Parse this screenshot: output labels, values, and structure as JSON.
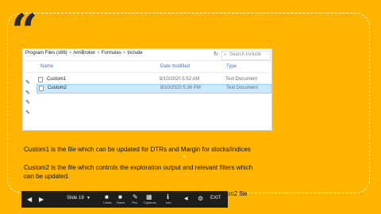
{
  "slide": {
    "quote_glyph": "“",
    "background_color": "#ffb400"
  },
  "explorer": {
    "breadcrumb": [
      "Program Files (x86)",
      "AmiBroker",
      "Formulas",
      "Include"
    ],
    "breadcrumb_sep": ">",
    "search_placeholder": "Search Include",
    "columns": {
      "name": "Name",
      "date": "Date modified",
      "type": "Type"
    },
    "files": [
      {
        "name": "Custom1",
        "date": "8/10/2020 5:52 AM",
        "type": "Text Document",
        "selected": false
      },
      {
        "name": "Custom2",
        "date": "8/10/2020 5:36 PM",
        "type": "Text Document",
        "selected": true
      }
    ]
  },
  "text": {
    "line1": "Custom1 is the file which can be updated for DTRs and Margin for stocks/indices",
    "line2a": "Custom2 is the file which controls the exploration output and relevant filters which",
    "line2b": "can be updated.",
    "line3_visible": "cm2 file"
  },
  "toolbar": {
    "slide_label": "Slide 19",
    "items": [
      {
        "glyph": "■",
        "label": "Clicks",
        "icon": "clicks-icon"
      },
      {
        "glyph": "■",
        "label": "Notes",
        "icon": "notes-icon"
      },
      {
        "glyph": "✎",
        "label": "Pen",
        "icon": "pen-icon"
      },
      {
        "glyph": "▦",
        "label": "Captions",
        "icon": "captions-icon"
      },
      {
        "glyph": "ℹ",
        "label": "Info",
        "icon": "info-icon"
      }
    ],
    "exit_label": "EXIT"
  }
}
